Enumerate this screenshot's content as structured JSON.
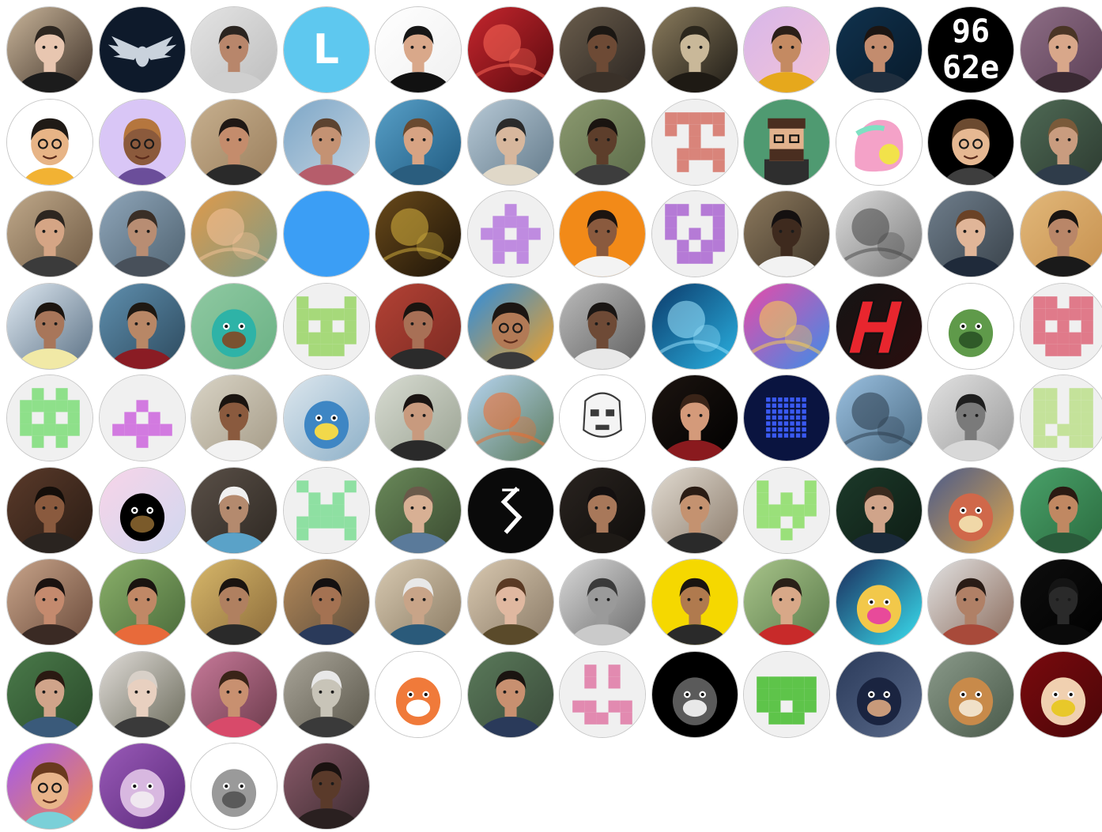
{
  "contributors": [
    {
      "kind": "photo",
      "bg": [
        "#c9b59a",
        "#3e3128"
      ],
      "face": "#e8c6b0",
      "hair": "#2d2620",
      "shirt": "#1c1c1c"
    },
    {
      "kind": "emblem",
      "bg": [
        "#0e1a2b",
        "#0e1a2b"
      ],
      "fg": "#c9d2dc",
      "icon": "winged-skull-icon"
    },
    {
      "kind": "photo",
      "bg": [
        "#e4e4e4",
        "#bdbdbd"
      ],
      "face": "#b8866b",
      "hair": "#2a2420",
      "shirt": "#cfcfcf"
    },
    {
      "kind": "initial",
      "bg": [
        "#5ec8ef",
        "#5ec8ef"
      ],
      "initial": "L"
    },
    {
      "kind": "photo",
      "bg": [
        "#ffffff",
        "#f0f0f0"
      ],
      "face": "#d9a88a",
      "hair": "#161616",
      "shirt": "#111111"
    },
    {
      "kind": "abstract",
      "bg": [
        "#c6262e",
        "#5a0a0e"
      ],
      "fg": "#ff6a5a"
    },
    {
      "kind": "photo",
      "bg": [
        "#6b5e4d",
        "#2a2420"
      ],
      "face": "#6d4a35",
      "hair": "#1b1713",
      "shirt": "#3a3129"
    },
    {
      "kind": "photo",
      "bg": [
        "#8c7d5e",
        "#1c1914"
      ],
      "face": "#c9b899",
      "hair": "#2b261c",
      "shirt": "#1e1a14"
    },
    {
      "kind": "photo",
      "bg": [
        "#d7b6ea",
        "#f4c4d7"
      ],
      "face": "#c48a62",
      "hair": "#2a1f18",
      "shirt": "#e6a81c"
    },
    {
      "kind": "photo",
      "bg": [
        "#10324e",
        "#081a2a"
      ],
      "face": "#c38c6e",
      "hair": "#1c1512",
      "shirt": "#1f2e3e"
    },
    {
      "kind": "hex",
      "bg": [
        "#000000",
        "#000000"
      ],
      "lines": [
        "96",
        "62e"
      ]
    },
    {
      "kind": "photo",
      "bg": [
        "#8e6e86",
        "#5b3f55"
      ],
      "face": "#d8a78a",
      "hair": "#4a3526",
      "shirt": "#3a2a33"
    },
    {
      "kind": "memoji",
      "bg": [
        "#ffffff",
        "#ffffff"
      ],
      "face": "#e7b486",
      "hair": "#1f1a16",
      "shirt": "#f2b233"
    },
    {
      "kind": "memoji",
      "bg": [
        "#d9c6f6",
        "#d9c6f6"
      ],
      "face": "#8b5a3c",
      "hair": "#b5763e",
      "shirt": "#6b4e9a"
    },
    {
      "kind": "photo",
      "bg": [
        "#c7b08f",
        "#9a7e5c"
      ],
      "face": "#c48c6c",
      "hair": "#1f1815",
      "shirt": "#2a2a2a"
    },
    {
      "kind": "photo",
      "bg": [
        "#7ca6c7",
        "#c9d7e3"
      ],
      "face": "#c49273",
      "hair": "#5c4330",
      "shirt": "#b65d6b"
    },
    {
      "kind": "photo",
      "bg": [
        "#58a0c8",
        "#1f5a80"
      ],
      "face": "#d7a383",
      "hair": "#6a4a30",
      "shirt": "#2a5d7e"
    },
    {
      "kind": "photo",
      "bg": [
        "#b7c9d6",
        "#637a8a"
      ],
      "face": "#d7b79d",
      "hair": "#2b2b2b",
      "shirt": "#e0d8c8"
    },
    {
      "kind": "photo",
      "bg": [
        "#8c9a70",
        "#5a6a48"
      ],
      "face": "#5d3e2b",
      "hair": "#1a1410",
      "shirt": "#3d3d3d"
    },
    {
      "kind": "identicon",
      "bg": [
        "#f0f0f0",
        "#f0f0f0"
      ],
      "fg": "#d9847a",
      "pattern": "1111110101001000111101001"
    },
    {
      "kind": "pixel",
      "bg": [
        "#4f9a71",
        "#4f9a71"
      ],
      "face": "#e2b28d",
      "hair": "#4a2e20",
      "shirt": "#2e2e2e"
    },
    {
      "kind": "sticker",
      "bg": [
        "#ffffff",
        "#ffffff"
      ],
      "fg": "#f4a2c8",
      "fg2": "#7ee0c2"
    },
    {
      "kind": "memoji",
      "bg": [
        "#000000",
        "#000000"
      ],
      "face": "#e6b892",
      "hair": "#6b4a30",
      "shirt": "#3e3e3e"
    },
    {
      "kind": "photo",
      "bg": [
        "#4f6a55",
        "#2c3a30"
      ],
      "face": "#c99c7f",
      "hair": "#7a5a3a",
      "shirt": "#2f3c4a"
    },
    {
      "kind": "photo",
      "bg": [
        "#c0a98a",
        "#6f5a44"
      ],
      "face": "#d5a585",
      "hair": "#2d2620",
      "shirt": "#3b3b3b"
    },
    {
      "kind": "photo",
      "bg": [
        "#8fa6ba",
        "#4f6270"
      ],
      "face": "#b88d73",
      "hair": "#3a2e26",
      "shirt": "#48505a"
    },
    {
      "kind": "abstract",
      "bg": [
        "#e09a4a",
        "#7d9b86"
      ],
      "fg": "#f6c39a"
    },
    {
      "kind": "solid",
      "bg": [
        "#3b9ef5",
        "#3b9ef5"
      ]
    },
    {
      "kind": "abstract",
      "bg": [
        "#6a4a1a",
        "#1c1308"
      ],
      "fg": "#d8b440"
    },
    {
      "kind": "identicon",
      "bg": [
        "#f0f0f0",
        "#f0f0f0"
      ],
      "fg": "#bf8be0",
      "pattern": "0010001110110110111001010"
    },
    {
      "kind": "photo",
      "bg": [
        "#f28a18",
        "#f28a18"
      ],
      "face": "#8a5a3e",
      "hair": "#1c1410",
      "shirt": "#f3f3f3"
    },
    {
      "kind": "identicon",
      "bg": [
        "#f0f0f0",
        "#f0f0f0"
      ],
      "fg": "#b57ad6",
      "pattern": "1101110001101010101101110"
    },
    {
      "kind": "photo",
      "bg": [
        "#8d7a5e",
        "#3e3428"
      ],
      "face": "#3e2a1e",
      "hair": "#141010",
      "shirt": "#f2f2f2"
    },
    {
      "kind": "abstract",
      "bg": [
        "#dddddd",
        "#7a7a7a"
      ],
      "fg": "#444444"
    },
    {
      "kind": "photo",
      "bg": [
        "#6f7e8c",
        "#39424a"
      ],
      "face": "#e0b598",
      "hair": "#6a4226",
      "shirt": "#1f2a3a"
    },
    {
      "kind": "photo",
      "bg": [
        "#e2b87a",
        "#c6904e"
      ],
      "face": "#b98668",
      "hair": "#1a1512",
      "shirt": "#1a1a1a"
    },
    {
      "kind": "photo",
      "bg": [
        "#dfe9f2",
        "#5a7084"
      ],
      "face": "#a8765a",
      "hair": "#1c1510",
      "shirt": "#f1e9a6"
    },
    {
      "kind": "photo",
      "bg": [
        "#5f8fae",
        "#2d4a5e"
      ],
      "face": "#b88766",
      "hair": "#1e1812",
      "shirt": "#8a1c24"
    },
    {
      "kind": "cartoon",
      "bg": [
        "#8fc9a2",
        "#6ab184"
      ],
      "fg": "#2eb3a7",
      "fg2": "#7a5230"
    },
    {
      "kind": "identicon",
      "bg": [
        "#f0f0f0",
        "#f0f0f0"
      ],
      "fg": "#a6d97a",
      "pattern": "1000111111101011111101110"
    },
    {
      "kind": "photo",
      "bg": [
        "#b44235",
        "#7a2a22"
      ],
      "face": "#a87056",
      "hair": "#1a1410",
      "shirt": "#2b2b2b"
    },
    {
      "kind": "memoji",
      "bg": [
        "#2b8de0",
        "#f2a024"
      ],
      "face": "#b27a56",
      "hair": "#1c1612",
      "shirt": "#3a3a3a"
    },
    {
      "kind": "photo",
      "bg": [
        "#bcbcbc",
        "#5e5e5e"
      ],
      "face": "#6e4a36",
      "hair": "#1a1614",
      "shirt": "#e8e8e8"
    },
    {
      "kind": "abstract",
      "bg": [
        "#0c3a6a",
        "#2ab2e2"
      ],
      "fg": "#9ee6ff"
    },
    {
      "kind": "abstract",
      "bg": [
        "#e84aa8",
        "#3c8ee8"
      ],
      "fg": "#ffd24a"
    },
    {
      "kind": "emblem",
      "bg": [
        "#141414",
        "#2a0e0e"
      ],
      "fg": "#e8262e",
      "icon": "h-logo-icon"
    },
    {
      "kind": "cartoon",
      "bg": [
        "#ffffff",
        "#ffffff"
      ],
      "fg": "#5f9a4a",
      "fg2": "#2f5a28"
    },
    {
      "kind": "identicon",
      "bg": [
        "#f0f0f0",
        "#f0f0f0"
      ],
      "fg": "#e07a8a",
      "pattern": "1101111111101011111101110"
    },
    {
      "kind": "identicon",
      "bg": [
        "#f0f0f0",
        "#f0f0f0"
      ],
      "fg": "#8ee08a",
      "pattern": "0101011111101011111101010"
    },
    {
      "kind": "identicon",
      "bg": [
        "#f0f0f0",
        "#f0f0f0"
      ],
      "fg": "#d27ae0",
      "pattern": "0000000100010101111100100"
    },
    {
      "kind": "photo",
      "bg": [
        "#d9d4c6",
        "#a49a86"
      ],
      "face": "#8a5a3e",
      "hair": "#1a1410",
      "shirt": "#f2f2f2"
    },
    {
      "kind": "cartoon",
      "bg": [
        "#dde7ee",
        "#8db0c8"
      ],
      "fg": "#3e86c4",
      "fg2": "#f2d84a"
    },
    {
      "kind": "photo",
      "bg": [
        "#d8dcd2",
        "#9aa292"
      ],
      "face": "#c89a7e",
      "hair": "#1a1412",
      "shirt": "#2a2a2a"
    },
    {
      "kind": "abstract",
      "bg": [
        "#b6d4f0",
        "#5a7a5a"
      ],
      "fg": "#f26a2a"
    },
    {
      "kind": "emblem",
      "bg": [
        "#ffffff",
        "#ffffff"
      ],
      "fg": "#3a3a3a",
      "icon": "stormtrooper-icon"
    },
    {
      "kind": "photo",
      "bg": [
        "#1c1410",
        "#000000"
      ],
      "face": "#d49a7a",
      "hair": "#3a2418",
      "shirt": "#8a1a1e"
    },
    {
      "kind": "emblem",
      "bg": [
        "#0a1440",
        "#0a1440"
      ],
      "fg": "#3a5af2",
      "icon": "led-grid-icon"
    },
    {
      "kind": "abstract",
      "bg": [
        "#9ac0e0",
        "#4a6a82"
      ],
      "fg": "#2a3a4a"
    },
    {
      "kind": "photo",
      "bg": [
        "#e2e2e2",
        "#9a9a9a"
      ],
      "face": "#7a7a7a",
      "hair": "#1e1e1e",
      "shirt": "#d8d8d8"
    },
    {
      "kind": "identicon",
      "bg": [
        "#f0f0f0",
        "#f0f0f0"
      ],
      "fg": "#c4e29a",
      "pattern": "1101111011110111011111011"
    },
    {
      "kind": "photo",
      "bg": [
        "#5a3a2a",
        "#2a1c14"
      ],
      "face": "#8a5a3e",
      "hair": "#140e0a",
      "shirt": "#2a2420"
    },
    {
      "kind": "cartoon",
      "bg": [
        "#f8d4e8",
        "#d0d8f0"
      ],
      "fg": "#000000",
      "fg2": "#7a5a2a"
    },
    {
      "kind": "photo",
      "bg": [
        "#5a5048",
        "#2e2822"
      ],
      "face": "#b48a6e",
      "hair": "#f0f0f0",
      "shirt": "#5aa2c8"
    },
    {
      "kind": "identicon",
      "bg": [
        "#f0f0f0",
        "#f0f0f0"
      ],
      "fg": "#8ee0a2",
      "pattern": "1000101010011101111110001"
    },
    {
      "kind": "photo",
      "bg": [
        "#6a8a5a",
        "#3a4a30"
      ],
      "face": "#d8b094",
      "hair": "#6a5a4a",
      "shirt": "#5a7a9a"
    },
    {
      "kind": "emblem",
      "bg": [
        "#0a0a0a",
        "#0a0a0a"
      ],
      "fg": "#ffffff",
      "icon": "s-logo-icon"
    },
    {
      "kind": "photo",
      "bg": [
        "#2a2420",
        "#0e0c0a"
      ],
      "face": "#a8785a",
      "hair": "#141010",
      "shirt": "#1e1a16"
    },
    {
      "kind": "photo",
      "bg": [
        "#e2dcd2",
        "#8a7a6a"
      ],
      "face": "#c49270",
      "hair": "#2a1c14",
      "shirt": "#2a2a2a"
    },
    {
      "kind": "identicon",
      "bg": [
        "#f0f0f0",
        "#f0f0f0"
      ],
      "fg": "#9ae07a",
      "pattern": "1000110101111111101000100"
    },
    {
      "kind": "photo",
      "bg": [
        "#1c3a2a",
        "#0e1c14"
      ],
      "face": "#d0a48a",
      "hair": "#3a2a1e",
      "shirt": "#1a2a3a"
    },
    {
      "kind": "cartoon",
      "bg": [
        "#4a5a8a",
        "#e0a84a"
      ],
      "fg": "#d0684a",
      "fg2": "#f0d8a8"
    },
    {
      "kind": "photo",
      "bg": [
        "#4aa26a",
        "#2a6a3e"
      ],
      "face": "#c08862",
      "hair": "#2a1a12",
      "shirt": "#2a5a3a"
    },
    {
      "kind": "photo",
      "bg": [
        "#c8a48a",
        "#6a4a3a"
      ],
      "face": "#c48a6e",
      "hair": "#1a1210",
      "shirt": "#3a2a24"
    },
    {
      "kind": "photo",
      "bg": [
        "#8ab06a",
        "#4a6a3a"
      ],
      "face": "#c08866",
      "hair": "#1a1410",
      "shirt": "#e86a3a"
    },
    {
      "kind": "photo",
      "bg": [
        "#d8b86a",
        "#8a6a3a"
      ],
      "face": "#b08060",
      "hair": "#1a1410",
      "shirt": "#2a2a2a"
    },
    {
      "kind": "photo",
      "bg": [
        "#b48a5a",
        "#5a4a3a"
      ],
      "face": "#a47252",
      "hair": "#141010",
      "shirt": "#2a3a5a"
    },
    {
      "kind": "photo",
      "bg": [
        "#d8cab2",
        "#8a7a62"
      ],
      "face": "#c8a488",
      "hair": "#e8e8e8",
      "shirt": "#2a5a7a"
    },
    {
      "kind": "photo",
      "bg": [
        "#d8c8b0",
        "#8a7a66"
      ],
      "face": "#e0b8a0",
      "hair": "#5a3a24",
      "shirt": "#5a4a2a"
    },
    {
      "kind": "photo",
      "bg": [
        "#d8d8d8",
        "#6a6a6a"
      ],
      "face": "#9a9a9a",
      "hair": "#3a3a3a",
      "shirt": "#cacaca"
    },
    {
      "kind": "photo",
      "bg": [
        "#f5d800",
        "#f5d800"
      ],
      "face": "#b07a4e",
      "hair": "#1a1410",
      "shirt": "#2a2a2a"
    },
    {
      "kind": "photo",
      "bg": [
        "#a8c48a",
        "#5a7a4a"
      ],
      "face": "#d8a888",
      "hair": "#2a2018",
      "shirt": "#c82a2a"
    },
    {
      "kind": "cartoon",
      "bg": [
        "#1a2a5a",
        "#3ae0f0"
      ],
      "fg": "#f2c84a",
      "fg2": "#e84a9a"
    },
    {
      "kind": "photo",
      "bg": [
        "#e2e2e2",
        "#8a6a5a"
      ],
      "face": "#b08066",
      "hair": "#2a1c16",
      "shirt": "#a84a3a"
    },
    {
      "kind": "photo",
      "bg": [
        "#0e0e0e",
        "#000000"
      ],
      "face": "#2a2a2a",
      "hair": "#141414",
      "shirt": "#0a0a0a"
    },
    {
      "kind": "photo",
      "bg": [
        "#4a7a4a",
        "#2a4a2a"
      ],
      "face": "#d0a48a",
      "hair": "#2a1a12",
      "shirt": "#3a5a7a"
    },
    {
      "kind": "photo",
      "bg": [
        "#e0dcd8",
        "#6a6a5a"
      ],
      "face": "#e8d0c0",
      "hair": "#d8d0c8",
      "shirt": "#3a3a3a"
    },
    {
      "kind": "photo",
      "bg": [
        "#c87a9a",
        "#6a3a4a"
      ],
      "face": "#c89070",
      "hair": "#3a2418",
      "shirt": "#d84a6a"
    },
    {
      "kind": "photo",
      "bg": [
        "#aaa69a",
        "#5a564a"
      ],
      "face": "#c8c4b8",
      "hair": "#e8e8e8",
      "shirt": "#3a3a3a"
    },
    {
      "kind": "cartoon",
      "bg": [
        "#ffffff",
        "#ffffff"
      ],
      "fg": "#f07a3a",
      "fg2": "#ffffff"
    },
    {
      "kind": "photo",
      "bg": [
        "#5a7a5a",
        "#3a4a3a"
      ],
      "face": "#c89070",
      "hair": "#1a1410",
      "shirt": "#2a3a5a"
    },
    {
      "kind": "identicon",
      "bg": [
        "#f0f0f0",
        "#f0f0f0"
      ],
      "fg": "#e28ab0",
      "pattern": "0101001010000001101101101"
    },
    {
      "kind": "cartoon",
      "bg": [
        "#000000",
        "#000000"
      ],
      "fg": "#5a5a5a",
      "fg2": "#e8e8e8"
    },
    {
      "kind": "identicon",
      "bg": [
        "#f0f0f0",
        "#f0f0f0"
      ],
      "fg": "#5ec44a",
      "pattern": "0000011111111111101101110"
    },
    {
      "kind": "cartoon",
      "bg": [
        "#2a3a5a",
        "#5a6a8a"
      ],
      "fg": "#1a2440",
      "fg2": "#c89a7a"
    },
    {
      "kind": "cartoon",
      "bg": [
        "#8a9a8a",
        "#4a5a4a"
      ],
      "fg": "#c88a4a",
      "fg2": "#f0e0c8"
    },
    {
      "kind": "cartoon",
      "bg": [
        "#7a0a0e",
        "#4a0608"
      ],
      "fg": "#f0d0b0",
      "fg2": "#e8c82a"
    },
    {
      "kind": "memoji",
      "bg": [
        "#a25af0",
        "#f0884a"
      ],
      "face": "#e8b48a",
      "hair": "#6a3a1e",
      "shirt": "#7ad0d8"
    },
    {
      "kind": "cartoon",
      "bg": [
        "#9a5ab8",
        "#5a2a7a"
      ],
      "fg": "#d8b8e0",
      "fg2": "#f0e8f0"
    },
    {
      "kind": "cartoon",
      "bg": [
        "#ffffff",
        "#ffffff"
      ],
      "fg": "#9a9a9a",
      "fg2": "#5a5a5a"
    },
    {
      "kind": "photo",
      "bg": [
        "#8a5a6a",
        "#3a2a2e"
      ],
      "face": "#5a3a2a",
      "hair": "#1a1210",
      "shirt": "#2a2020"
    }
  ]
}
